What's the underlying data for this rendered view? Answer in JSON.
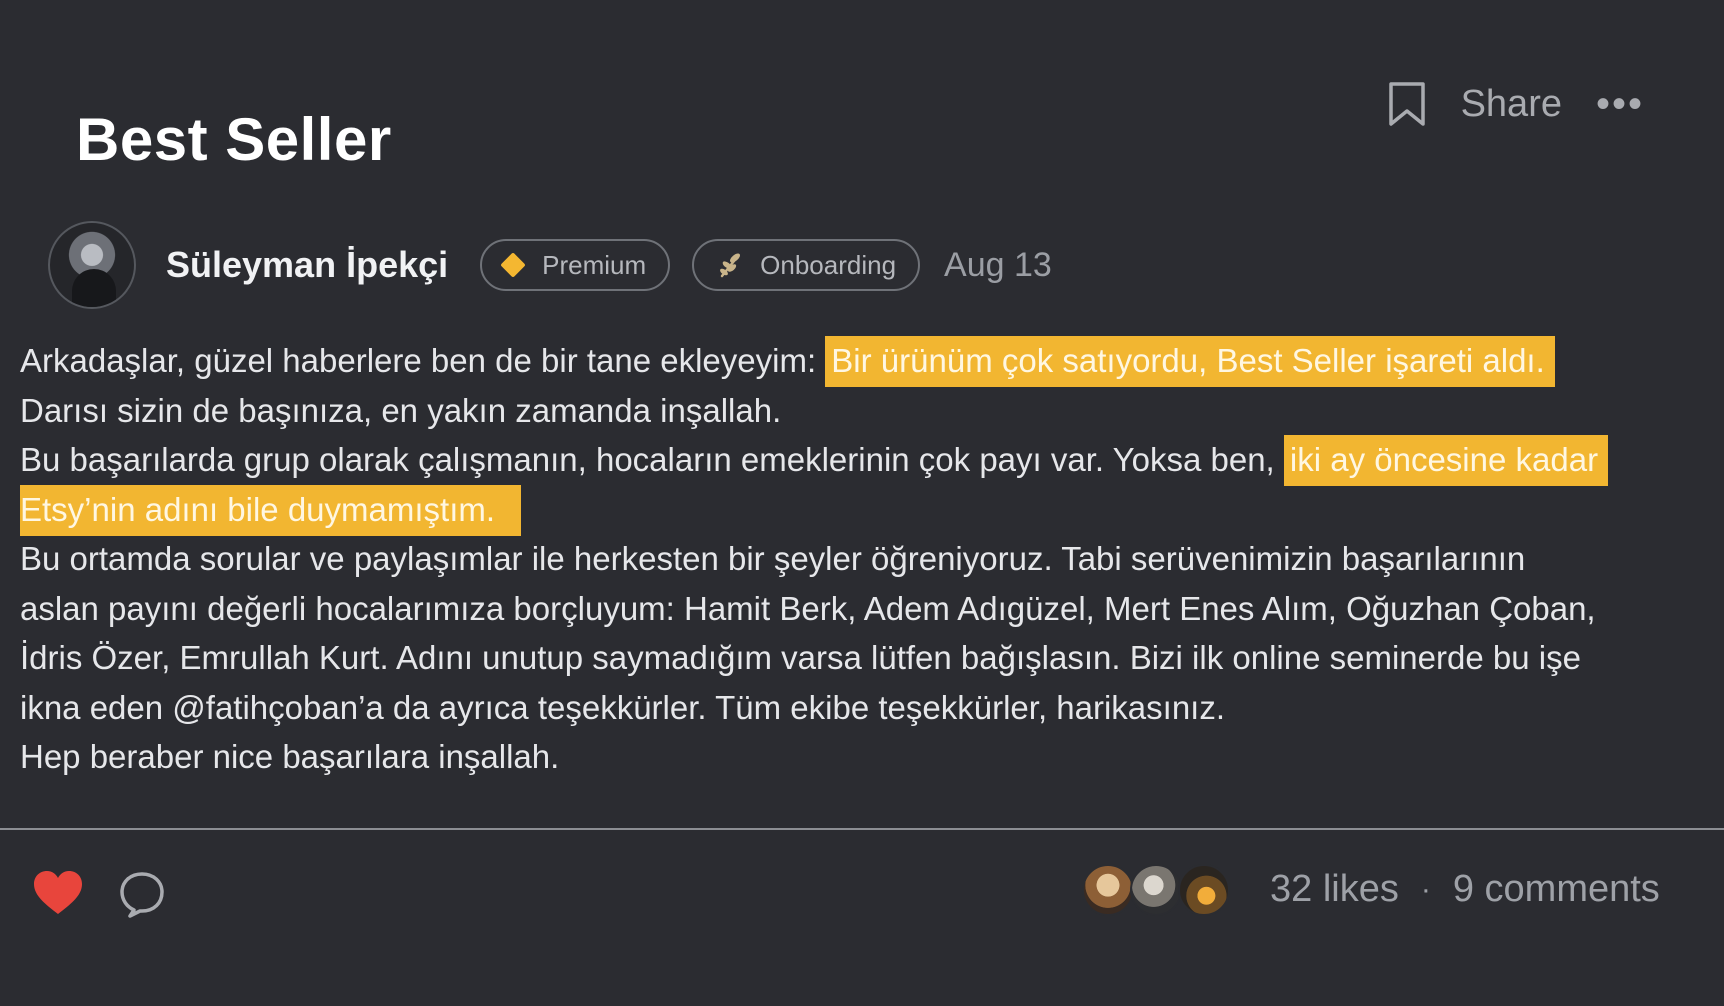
{
  "post": {
    "title": "Best Seller",
    "share_label": "Share",
    "more_label": "•••"
  },
  "author": {
    "name": "Süleyman İpekçi",
    "badges": {
      "premium": "Premium",
      "onboarding": "Onboarding"
    },
    "date": "Aug 13"
  },
  "body": {
    "p1_text": "Arkadaşlar, güzel haberlere ben de bir tane ekleyeyim: ",
    "p1_highlight": "Bir ürünüm çok satıyordu, Best Seller işareti aldı.",
    "p2_text": "Darısı sizin de başınıza, en yakın zamanda inşallah.",
    "p3_text": "Bu başarılarda grup olarak çalışmanın, hocaların emeklerinin çok payı var. Yoksa ben, ",
    "p3_highlight_a": "iki ay öncesine kadar",
    "p3_highlight_b": "Etsy’nin adını bile duymamıştım.",
    "p4_line1": "Bu ortamda sorular ve paylaşımlar ile herkesten bir şeyler öğreniyoruz. Tabi serüvenimizin başarılarının",
    "p4_line2": "aslan payını değerli hocalarımıza borçluyum: Hamit Berk, Adem Adıgüzel, Mert Enes Alım, Oğuzhan Çoban,",
    "p4_line3": "İdris Özer, Emrullah Kurt. Adını unutup saymadığım varsa lütfen bağışlasın. Bizi ilk online seminerde bu işe",
    "p4_line4": "ikna eden @fatihçoban’a da ayrıca teşekkürler. Tüm ekibe teşekkürler, harikasınız.",
    "p5_text": "Hep beraber nice başarılara inşallah."
  },
  "footer": {
    "likes": "32 likes",
    "separator": "·",
    "comments": "9 comments"
  },
  "colors": {
    "background": "#2b2c31",
    "highlight": "#f2b631",
    "heart": "#e8453c",
    "premium_diamond": "#f4b731"
  },
  "icons": {
    "bookmark": "bookmark-icon",
    "more": "more-icon",
    "premium": "diamond-icon",
    "onboarding": "sprout-icon",
    "like": "heart-icon",
    "comment": "comment-icon"
  }
}
